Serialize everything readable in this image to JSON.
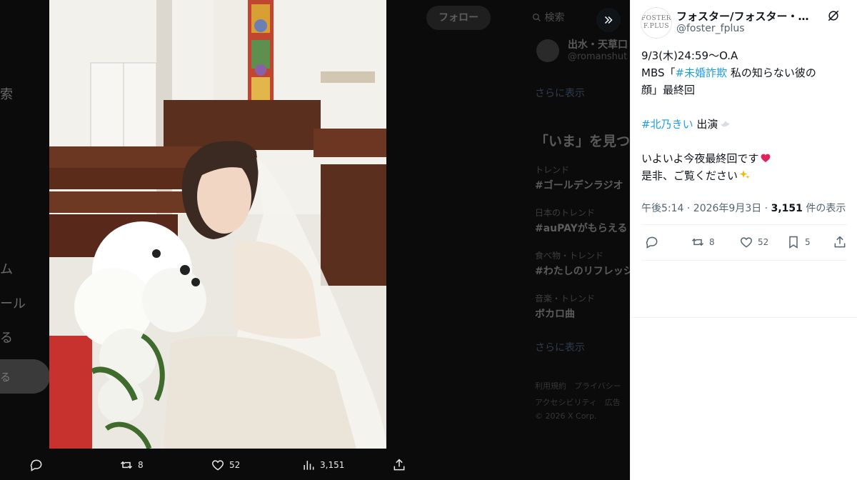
{
  "background": {
    "nav_fragments": [
      "索",
      "ム",
      "ール",
      "る"
    ],
    "nav_button_fragment": "る",
    "follow_label": "フォロー",
    "search_placeholder": "検索",
    "suggested_user_name": "出水・天草口",
    "suggested_user_handle": "@romanshut",
    "show_more_1": "さらに表示",
    "section_heading": "「いま」を見つ",
    "trends": [
      {
        "category": "トレンド",
        "name": "#ゴールデンラジオ"
      },
      {
        "category": "日本のトレンド",
        "name": "#auPAYがもらえる"
      },
      {
        "category": "食べ物・トレンド",
        "name": "#わたしのリフレッシ"
      },
      {
        "category": "音楽・トレンド",
        "name": "ボカロ曲"
      }
    ],
    "show_more_2": "さらに表示",
    "footer_line1": "利用規約　プライバシー",
    "footer_line2": "アクセシビリティ　広告",
    "footer_line3": "© 2026 X Corp."
  },
  "media_actions": {
    "retweets": "8",
    "likes": "52",
    "views": "3,151"
  },
  "tweet": {
    "avatar_text_1": "FOSTER",
    "avatar_text_2": "F.PLUS",
    "display_name": "フォスター/フォスター・プラス",
    "handle": "@foster_fplus",
    "line1": "9/3(木)24:59～O.A",
    "line2_prefix": "MBS「",
    "line2_hashtag": "#未婚詐欺",
    "line2_suffix": " 私の知らない彼の",
    "line3": "顔」最終回",
    "line4_hashtag": "#北乃きい",
    "line4_suffix": " 出演",
    "line5": "いよいよ今夜最終回です",
    "line6": "是非、ご覧ください",
    "meta_time": "午後5:14 · 2026年9月3日 · ",
    "meta_views_count": "3,151",
    "meta_views_label": " 件の表示",
    "retweets": "8",
    "likes": "52",
    "bookmarks": "5"
  },
  "colors": {
    "accent": "#1d9bf0",
    "text": "#0f1419",
    "secondary": "#536471",
    "overlay": "#000000"
  }
}
